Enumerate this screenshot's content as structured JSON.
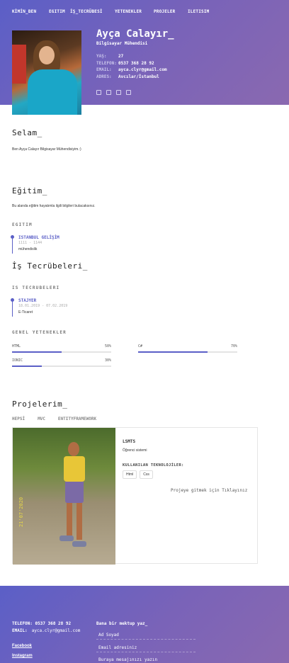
{
  "nav": [
    "KİMİN_BEN",
    "EGITIM",
    "İŞ_TECRÜBESİ",
    "YETENEKLER",
    "PROJELER",
    "ILETISIM"
  ],
  "profile": {
    "name": "Ayça Calayır_",
    "role": "Bilgisayar Mühendisi",
    "info": [
      {
        "k": "YAŞ:",
        "v": "27"
      },
      {
        "k": "TELEFON:",
        "v": "0537 368 28 92"
      },
      {
        "k": "EMAIL:",
        "v": "ayca.clyr@gmail.com"
      },
      {
        "k": "ADRES:",
        "v": "Avcılar/İstanbul"
      }
    ],
    "socials": [
      "facebook-icon",
      "instagram-icon",
      "linkedin-icon",
      "github-icon"
    ]
  },
  "about": {
    "title": "Selam_",
    "text": "Ben Ayça Calayır Bilgisayar Mühendisiyim.:)"
  },
  "education": {
    "title": "Eğitim_",
    "text": "Bu alanda eğitim hayatımla ilgili bilgileri bulacaksınız.",
    "subtitle": "EGITIM",
    "item": {
      "title": "ISTANBUL GELİŞİM",
      "date": "1111 - 1144",
      "desc": "mühendislik"
    }
  },
  "experience": {
    "title": "İş Tecrübeleri_",
    "subtitle": "IS TECRUBELERI",
    "item": {
      "title": "STAJYER",
      "date": "18.01.2019 - 07.02.2019",
      "desc": "E-Ticaret"
    }
  },
  "skills": {
    "subtitle": "GENEL YETENEKLER",
    "items": [
      {
        "name": "HTML",
        "label": "50%",
        "value": 0.5
      },
      {
        "name": "C#",
        "label": "70%",
        "value": 0.7
      },
      {
        "name": "IONIC",
        "label": "30%",
        "value": 0.3
      }
    ]
  },
  "projects": {
    "title": "Projelerim_",
    "filters": [
      "HEPSİ",
      "MVC",
      "ENTITYFRAMEWORK"
    ],
    "card": {
      "name": "LSMTS",
      "desc": "Öğrenci sistemi",
      "tech_label": "KULLANILAN TEKNOLOJİLER:",
      "tags": [
        "Html",
        "Css"
      ],
      "link": "Projeye gitmek için Tıklayınız",
      "photo_stamp": "21'07'2020"
    }
  },
  "footer": {
    "phone_label": "TELEFON:",
    "phone": "0537 368 28 92",
    "email_label": "EMAIL:",
    "email": "ayca.clyr@gmail.com",
    "link_facebook": "Facebook",
    "link_instagram": "Instagram",
    "form_title": "Bana bir mektup yaz_",
    "ph_name": "Ad Soyad",
    "ph_email": "Email adresiniz",
    "ph_message": "Buraya mesajınızı yazın"
  },
  "colors": {
    "accent": "#5b5fc7",
    "gradient_end": "#8a69b0"
  }
}
